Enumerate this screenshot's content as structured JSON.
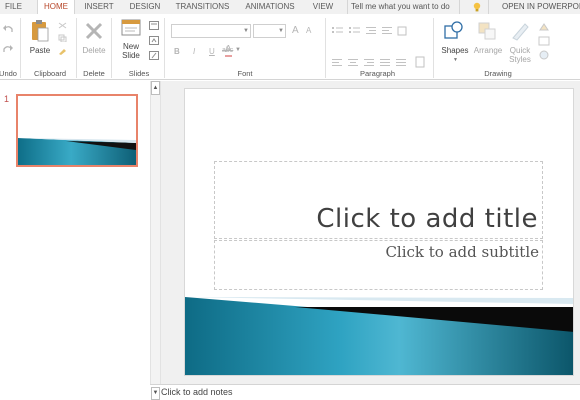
{
  "tabs": [
    {
      "label": "FILE",
      "active": false
    },
    {
      "label": "HOME",
      "active": true
    },
    {
      "label": "INSERT",
      "active": false
    },
    {
      "label": "DESIGN",
      "active": false
    },
    {
      "label": "TRANSITIONS",
      "active": false
    },
    {
      "label": "ANIMATIONS",
      "active": false
    },
    {
      "label": "VIEW",
      "active": false
    }
  ],
  "search": {
    "placeholder": "Tell me what you want to do"
  },
  "open_in_app": "OPEN IN POWERPOIN",
  "ribbon": {
    "undo_group": "Undo",
    "clipboard": {
      "label": "Clipboard",
      "paste": "Paste"
    },
    "delete": {
      "label": "Delete",
      "button": "Delete"
    },
    "slides": {
      "label": "Slides",
      "new_slide_line1": "New",
      "new_slide_line2": "Slide"
    },
    "font": {
      "label": "Font",
      "bold": "B",
      "italic": "I",
      "underline": "U",
      "strike": "abc",
      "grow": "A",
      "shrink": "A",
      "color": "A"
    },
    "paragraph": {
      "label": "Paragraph"
    },
    "drawing": {
      "label": "Drawing",
      "shapes": "Shapes",
      "arrange": "Arrange",
      "quick_styles_line1": "Quick",
      "quick_styles_line2": "Styles"
    }
  },
  "thumbnails": [
    {
      "number": "1"
    }
  ],
  "slide": {
    "title_placeholder": "Click to add title",
    "subtitle_placeholder": "Click to add subtitle"
  },
  "notes": {
    "placeholder": "Click to add notes"
  },
  "colors": {
    "accent": "#b7472a",
    "teal": "#1b8aa8",
    "teal_dark": "#0e5f76",
    "thumb_border": "#e8836a"
  },
  "icons": {
    "undo": "undo-icon",
    "redo": "redo-icon",
    "paste": "clipboard-icon",
    "format_painter": "brush-icon",
    "delete": "x-icon",
    "new_slide": "slide-icon",
    "shapes": "shapes-icon",
    "arrange": "arrange-icon",
    "quick_styles": "palette-icon",
    "lightbulb": "lightbulb-icon"
  }
}
